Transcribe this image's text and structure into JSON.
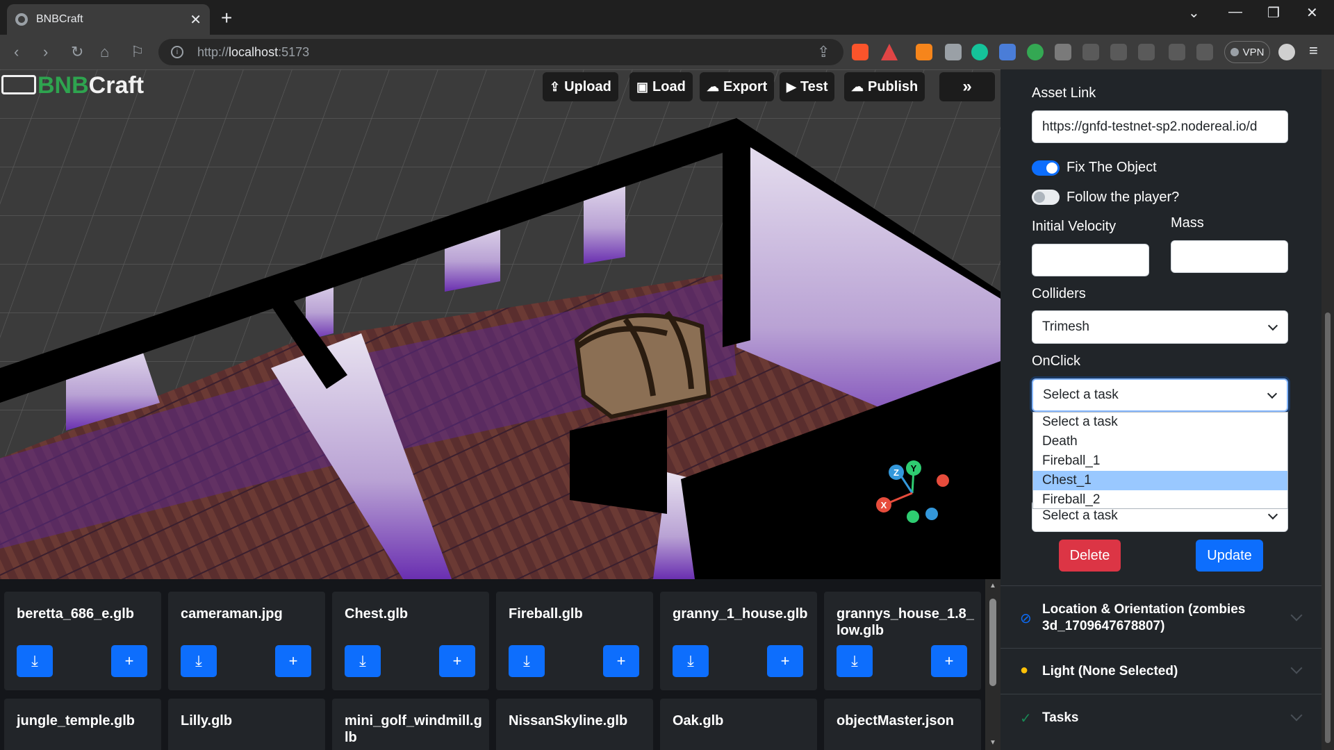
{
  "browser": {
    "tab_title": "BNBCraft",
    "url_prefix": "http://",
    "url_host": "localhost",
    "url_port": ":5173",
    "vpn_label": "VPN"
  },
  "app": {
    "logo_bnb": "BNB",
    "logo_craft": "Craft",
    "toolbar": {
      "upload": "Upload",
      "load": "Load",
      "export": "Export",
      "test": "Test",
      "publish": "Publish"
    }
  },
  "panel": {
    "asset_link_label": "Asset Link",
    "asset_link_value": "https://gnfd-testnet-sp2.nodereal.io/d",
    "fix_object_label": "Fix The Object",
    "fix_object_on": true,
    "follow_player_label": "Follow the player?",
    "follow_player_on": false,
    "initial_velocity_label": "Initial Velocity",
    "initial_velocity_value": "",
    "mass_label": "Mass",
    "mass_value": "",
    "colliders_label": "Colliders",
    "colliders_value": "Trimesh",
    "onclick_label": "OnClick",
    "onclick_value": "Select a task",
    "onclick_options": [
      "Select a task",
      "Death",
      "Fireball_1",
      "Chest_1",
      "Fireball_2"
    ],
    "onclick_highlighted": "Chest_1",
    "second_select_value": "Select a task",
    "delete_label": "Delete",
    "update_label": "Update",
    "accordions": {
      "location": "Location & Orientation (zombies 3d_1709647678807)",
      "light": "Light (None Selected)",
      "tasks": "Tasks"
    }
  },
  "assets": {
    "row1": [
      "beretta_686_e.glb",
      "cameraman.jpg",
      "Chest.glb",
      "Fireball.glb",
      "granny_1_house.glb",
      "grannys_house_1.8_low.glb"
    ],
    "row2": [
      "jungle_temple.glb",
      "Lilly.glb",
      "mini_golf_windmill.glb",
      "NissanSkyline.glb",
      "Oak.glb",
      "objectMaster.json"
    ]
  },
  "gizmo": {
    "x": "X",
    "y": "Y",
    "z": "Z"
  },
  "colors": {
    "accent": "#0d6efd",
    "danger": "#dc3545",
    "brand_green": "#2ea44f",
    "panel_bg": "#212529"
  }
}
